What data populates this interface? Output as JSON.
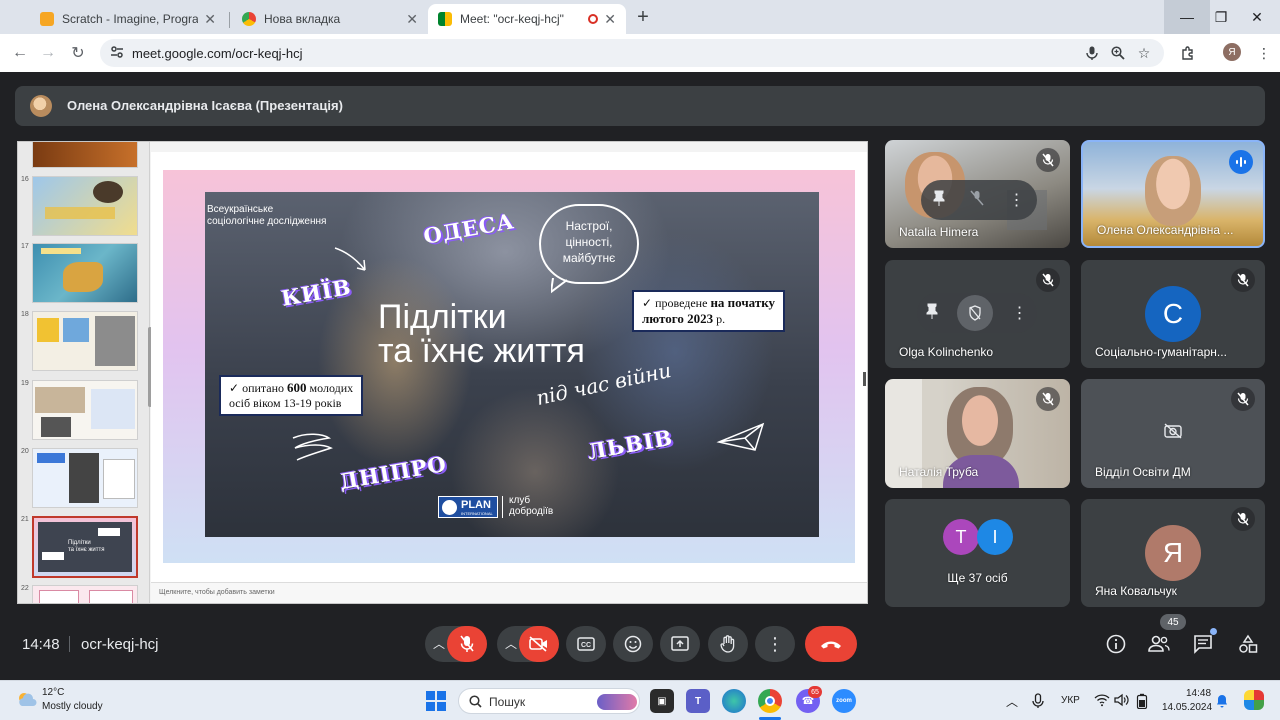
{
  "browser": {
    "tabs": [
      {
        "label": "Scratch - Imagine, Program, Sha",
        "active": false
      },
      {
        "label": "Нова вкладка",
        "active": false
      },
      {
        "label": "Meet: \"ocr-keqj-hcj\"",
        "active": true
      }
    ],
    "url": "meet.google.com/ocr-keqj-hcj",
    "profile_initial": "Я"
  },
  "meet": {
    "presenter_name": "Олена Олександрівна Ісаєва (Презентація)",
    "clock": "14:48",
    "meeting_code": "ocr-keqj-hcj",
    "participant_count": "45",
    "participants": [
      {
        "name": "Natalia Himera",
        "muted": true
      },
      {
        "name": "Олена Олександрівна ...",
        "speaking": true
      },
      {
        "name": "Olga Kolinchenko",
        "muted": true
      },
      {
        "name": "Соціально-гуманітарн...",
        "initial": "С",
        "muted": true
      },
      {
        "name": "Наталія Труба",
        "muted": true
      },
      {
        "name": "Відділ Освіти ДМ",
        "muted": true,
        "camera_off": true
      },
      {
        "name": "Ще 37 осіб",
        "initials": [
          "Т",
          "І"
        ]
      },
      {
        "name": "Яна Ковальчук",
        "initial": "Я",
        "muted": true
      }
    ],
    "colors": {
      "end_call": "#ea4335",
      "speaking": "#1a73e8",
      "avatar_c": "#1565c0",
      "avatar_ya": "#b07a6a",
      "avatar_t": "#ab47bc",
      "avatar_i": "#1e88e5"
    }
  },
  "slides": {
    "thumb_numbers": [
      "16",
      "17",
      "18",
      "19",
      "20",
      "21",
      "22"
    ],
    "selected": "21",
    "notes_placeholder": "Щелкните, чтобы добавить заметки",
    "current": {
      "survey_label_line1": "Всеукраїнське",
      "survey_label_line2": "соціологічне дослідження",
      "title_line1": "Підлітки",
      "title_line2": "та їхнє життя",
      "title_script": "під час війни",
      "bubble_line1": "Настрої,",
      "bubble_line2": "цінності,",
      "bubble_line3": "майбутнє",
      "callout1_pre": "проведене",
      "callout1_bold": "на початку",
      "callout1_line2": "лютого 2023",
      "callout1_suffix": "р.",
      "callout2_pre": "опитано",
      "callout2_bold": "600",
      "callout2_post": "молодих",
      "callout2_line2": "осіб віком 13-19 років",
      "cities": [
        "ОДЕСА",
        "КИЇВ",
        "ДНІПРО",
        "ЛЬВІВ"
      ],
      "logo_plan": "PLAN",
      "logo_intl": "INTERNATIONAL",
      "logo_club_line1": "клуб",
      "logo_club_line2": "добродіїв"
    }
  },
  "taskbar": {
    "weather_temp": "12°C",
    "weather_desc": "Mostly cloudy",
    "search_placeholder": "Пошук",
    "viber_badge": "65",
    "language": "УКР",
    "time": "14:48",
    "date": "14.05.2024"
  }
}
